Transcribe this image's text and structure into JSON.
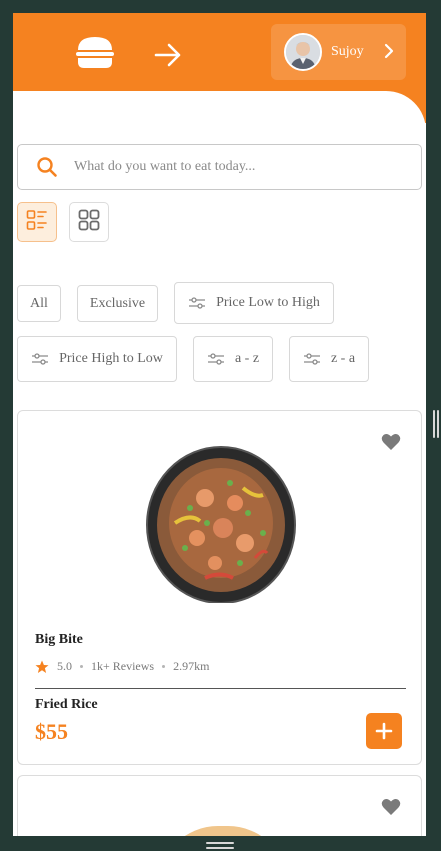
{
  "header": {
    "logo_icon": "burger-icon",
    "nav_icon": "arrow-right-icon",
    "user": {
      "name": "Sujoy",
      "avatar_icon": "user-avatar",
      "chevron_icon": "chevron-right-icon"
    },
    "bg_color": "#f58220"
  },
  "search": {
    "placeholder": "What do you want to eat today...",
    "value": "",
    "icon": "search-icon"
  },
  "view_toggles": [
    {
      "icon": "list-view-icon",
      "active": true
    },
    {
      "icon": "grid-view-icon",
      "active": false
    }
  ],
  "filters": [
    {
      "label": "All",
      "icon": ""
    },
    {
      "label": "Exclusive",
      "icon": ""
    },
    {
      "label": "Price Low to High",
      "icon": "sliders-icon"
    },
    {
      "label": "Price High to Low",
      "icon": "sliders-icon"
    },
    {
      "label": "a - z",
      "icon": "sliders-icon"
    },
    {
      "label": "z - a",
      "icon": "sliders-icon"
    }
  ],
  "cards": [
    {
      "restaurant": "Big Bite",
      "rating": "5.0",
      "reviews": "1k+ Reviews",
      "distance": "2.97km",
      "food": "Fried Rice",
      "price": "$55",
      "favorite_icon": "heart-icon",
      "add_icon": "plus-icon",
      "image": "fried-rice-plate"
    },
    {
      "favorite_icon": "heart-icon",
      "image": "burger-bun"
    }
  ],
  "accent_color": "#f58220"
}
